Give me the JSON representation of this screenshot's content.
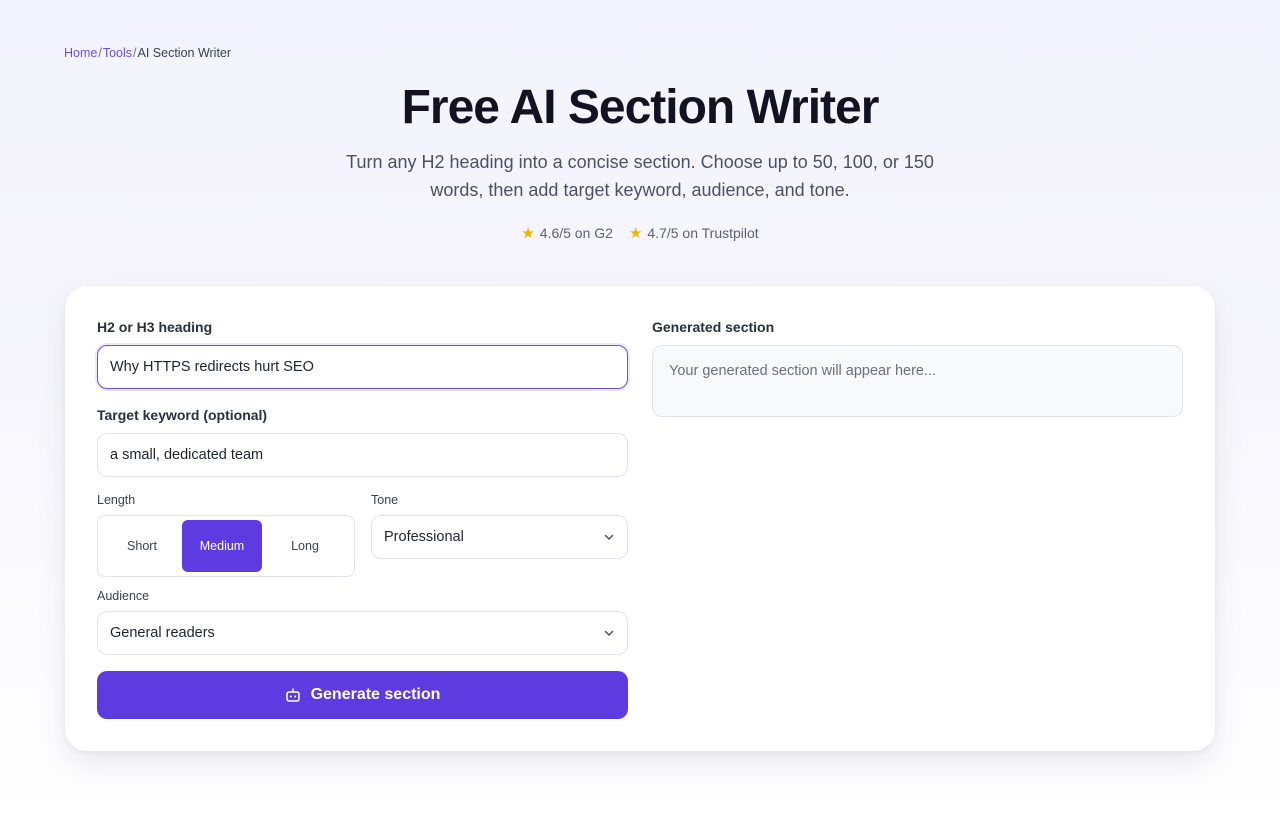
{
  "breadcrumb": {
    "home": "Home",
    "tools": "Tools",
    "current": "AI Section Writer",
    "separator": "/"
  },
  "header": {
    "title": "Free AI Section Writer",
    "subtitle": "Turn any H2 heading into a concise section. Choose up to 50, 100, or 150 words, then add target keyword, audience, and tone."
  },
  "ratings": [
    {
      "text": "4.6/5 on G2"
    },
    {
      "text": "4.7/5 on Trustpilot"
    }
  ],
  "form": {
    "heading_label": "H2 or H3 heading",
    "heading_value": "Why HTTPS redirects hurt SEO",
    "keyword_label": "Target keyword (optional)",
    "keyword_value": "a small, dedicated team",
    "length_label": "Length",
    "length_options": [
      "Short",
      "Medium",
      "Long"
    ],
    "length_selected": "Medium",
    "tone_label": "Tone",
    "tone_value": "Professional",
    "audience_label": "Audience",
    "audience_value": "General readers",
    "generate_label": "Generate section"
  },
  "output": {
    "label": "Generated section",
    "placeholder": "Your generated section will appear here..."
  },
  "colors": {
    "accent": "#5e3be0",
    "star": "#f5b301",
    "link": "#6b4ee6"
  },
  "icons": {
    "star": "star-icon",
    "chevron": "chevron-down-icon",
    "generate": "robot-icon"
  }
}
